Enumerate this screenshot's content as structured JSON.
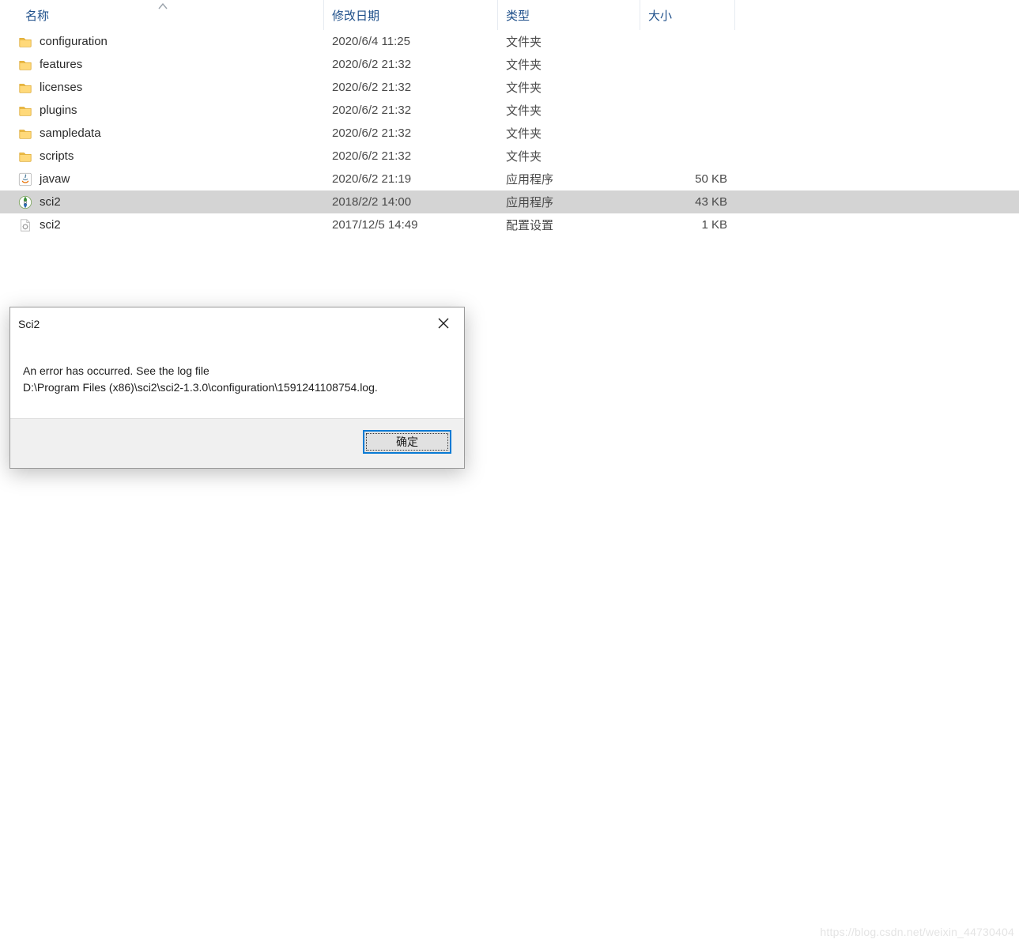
{
  "headers": {
    "name": "名称",
    "date": "修改日期",
    "type": "类型",
    "size": "大小"
  },
  "rows": [
    {
      "icon": "folder",
      "name": "configuration",
      "date": "2020/6/4 11:25",
      "type": "文件夹",
      "size": "",
      "selected": false
    },
    {
      "icon": "folder",
      "name": "features",
      "date": "2020/6/2 21:32",
      "type": "文件夹",
      "size": "",
      "selected": false
    },
    {
      "icon": "folder",
      "name": "licenses",
      "date": "2020/6/2 21:32",
      "type": "文件夹",
      "size": "",
      "selected": false
    },
    {
      "icon": "folder",
      "name": "plugins",
      "date": "2020/6/2 21:32",
      "type": "文件夹",
      "size": "",
      "selected": false
    },
    {
      "icon": "folder",
      "name": "sampledata",
      "date": "2020/6/2 21:32",
      "type": "文件夹",
      "size": "",
      "selected": false
    },
    {
      "icon": "folder",
      "name": "scripts",
      "date": "2020/6/2 21:32",
      "type": "文件夹",
      "size": "",
      "selected": false
    },
    {
      "icon": "java",
      "name": "javaw",
      "date": "2020/6/2 21:19",
      "type": "应用程序",
      "size": "50 KB",
      "selected": false
    },
    {
      "icon": "app",
      "name": "sci2",
      "date": "2018/2/2 14:00",
      "type": "应用程序",
      "size": "43 KB",
      "selected": true
    },
    {
      "icon": "config",
      "name": "sci2",
      "date": "2017/12/5 14:49",
      "type": "配置设置",
      "size": "1 KB",
      "selected": false
    }
  ],
  "dialog": {
    "title": "Sci2",
    "line1": "An error has occurred. See the log file",
    "line2": "D:\\Program Files (x86)\\sci2\\sci2-1.3.0\\configuration\\1591241108754.log.",
    "ok": "确定"
  },
  "watermark": "https://blog.csdn.net/weixin_44730404"
}
